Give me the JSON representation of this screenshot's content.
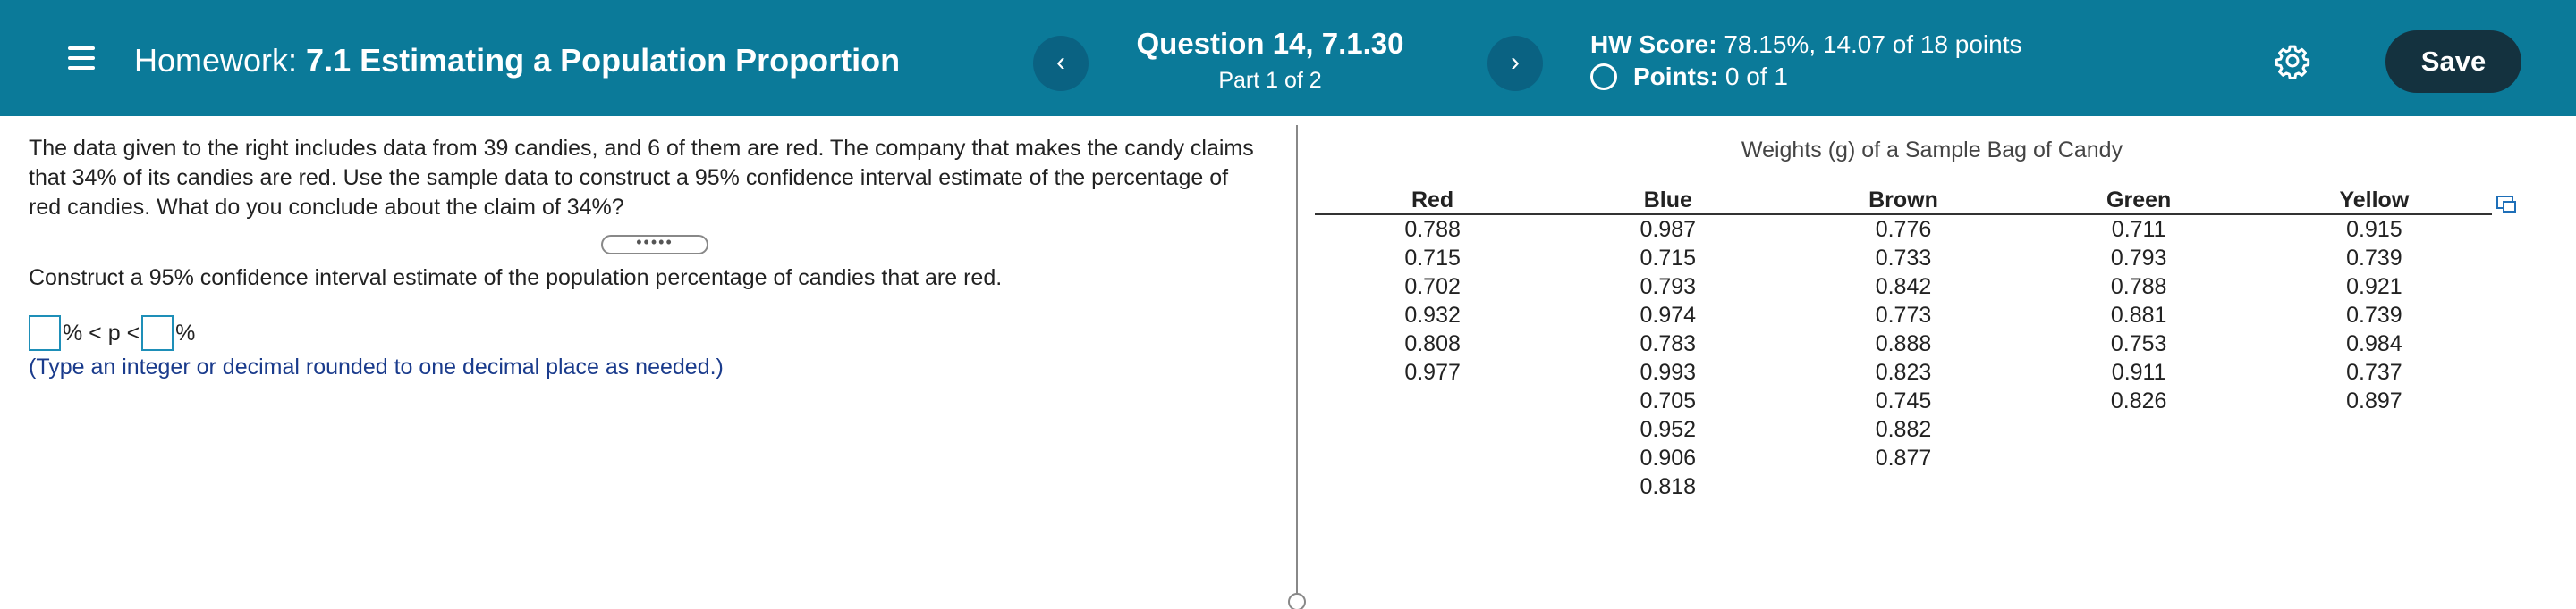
{
  "header": {
    "title_prefix": "Homework:",
    "title_name": "7.1 Estimating a Population Proportion",
    "question_title": "Question 14, 7.1.30",
    "question_part": "Part 1 of 2",
    "prev_label": "‹",
    "next_label": "›",
    "score_label": "HW Score:",
    "score_value": "78.15%, 14.07 of 18 points",
    "points_label": "Points:",
    "points_value": "0 of 1",
    "save_label": "Save",
    "colors": {
      "bar": "#0b7a99",
      "save_button": "#14323f"
    }
  },
  "problem": {
    "text": "The data given to the right includes data from 39 candies, and 6 of them are red. The company that makes the candy claims that 34% of its candies are red. Use the sample data to construct a 95% confidence interval estimate of the percentage of red candies. What do you conclude about the claim of 34%?",
    "expander_label": "•••••",
    "construct_text": "Construct a 95% confidence interval estimate of the population percentage of candies that are red.",
    "answer_parts": [
      "% < p <",
      "%"
    ],
    "hint": "(Type an integer or decimal rounded to one decimal place as needed.)"
  },
  "table": {
    "caption": "Weights (g) of a Sample Bag of Candy",
    "headers": [
      "Red",
      "Blue",
      "Brown",
      "Green",
      "Yellow"
    ],
    "rows": [
      [
        "0.788",
        "0.987",
        "0.776",
        "0.711",
        "0.915"
      ],
      [
        "0.715",
        "0.715",
        "0.733",
        "0.793",
        "0.739"
      ],
      [
        "0.702",
        "0.793",
        "0.842",
        "0.788",
        "0.921"
      ],
      [
        "0.932",
        "0.974",
        "0.773",
        "0.881",
        "0.739"
      ],
      [
        "0.808",
        "0.783",
        "0.888",
        "0.753",
        "0.984"
      ],
      [
        "0.977",
        "0.993",
        "0.823",
        "0.911",
        "0.737"
      ],
      [
        "",
        "0.705",
        "0.745",
        "0.826",
        "0.897"
      ],
      [
        "",
        "0.952",
        "0.882",
        "",
        ""
      ],
      [
        "",
        "0.906",
        "0.877",
        "",
        ""
      ],
      [
        "",
        "0.818",
        "",
        "",
        ""
      ]
    ]
  }
}
